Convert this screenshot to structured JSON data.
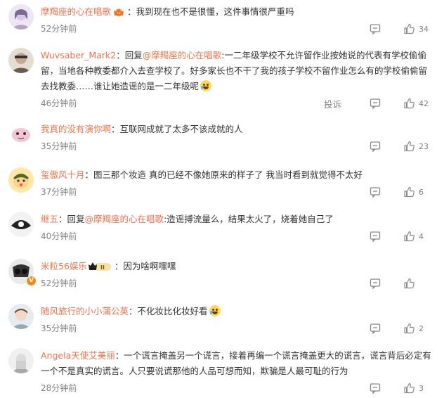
{
  "report_label": "投诉",
  "comments": [
    {
      "user": "摩羯座的心在唱歌",
      "has_crown_badge": true,
      "colon": "：",
      "text_before": "我到现在也不是很懂，这件事情很严重吗",
      "time": "52分钟前",
      "likes": "34",
      "avatar_icon": "anime-girl-avatar",
      "accent": "#eb7350"
    },
    {
      "user": "Wuvsaber_Mark2",
      "colon": "：",
      "reply_prefix": "回复",
      "mention": "@摩羯座的心在唱歌",
      "text_before": ":一二年级学校不允许留作业按她说的代表有学校偷偷留，当地各种教委都介入去查学校了。好多家长也不干了我的孩子学校不留作业怎么有的学校偷偷留去找教委……谁让她造谣的是一二年级呢",
      "time": "46分钟前",
      "likes": "42",
      "emoji": "laugh-cry-emoji"
    },
    {
      "user": "我真的没有演你啊",
      "colon": "：",
      "text_before": "互联网成就了太多不该成就的人",
      "time": "35分钟前",
      "likes": "23"
    },
    {
      "user": "玺傲风十月",
      "colon": "：",
      "text_before": "图三那个妆造 真的已经不像她原来的样子了 我当时看到就觉得不太好",
      "time": "37分钟前",
      "likes": "6"
    },
    {
      "user": "继五",
      "colon": "：",
      "reply_prefix": "回复",
      "mention": "@摩羯座的心在唱歌",
      "text_before": ":造谣搏流量么，结果太火了，烧着她自己了",
      "time": "40分钟前",
      "likes": "4"
    },
    {
      "user": "米粒56娱乐",
      "has_rank_badge": true,
      "colon": "：",
      "text_before": "因为啥啊嘿嘿",
      "time": "52分钟前",
      "likes": "",
      "verified": true
    },
    {
      "user": "随风旅行的小小蒲公英",
      "colon": "：",
      "text_before": "不化妆比化妆好看",
      "time": "35分钟前",
      "likes": "2",
      "emoji": "laugh-cry-emoji"
    },
    {
      "user": "Angela天使艾美丽",
      "colon": "：",
      "text_before": "一个谎言掩盖另一个谎言，接着再编一个谎言掩盖更大的谎言，谎言背后必定有一个不是真实的谎言。人只要说谎那他的人品可想而知，欺骗是人最可耻的行为",
      "time": "28分钟前",
      "likes": "3"
    }
  ]
}
